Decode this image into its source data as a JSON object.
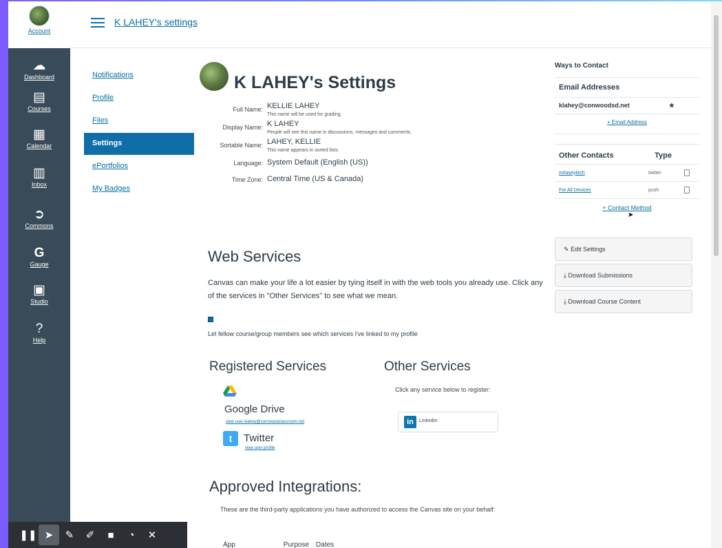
{
  "global_nav": {
    "account_label": "Account",
    "items": [
      {
        "label": "Dashboard",
        "icon": "dashboard-icon",
        "glyph": "☁"
      },
      {
        "label": "Courses",
        "icon": "courses-icon",
        "glyph": "▤"
      },
      {
        "label": "Calendar",
        "icon": "calendar-icon",
        "glyph": "▦"
      },
      {
        "label": "Inbox",
        "icon": "inbox-icon",
        "glyph": "▥"
      },
      {
        "label": "Commons",
        "icon": "commons-icon",
        "glyph": "➲"
      },
      {
        "label": "Gauge",
        "icon": "gauge-icon",
        "glyph": "G"
      },
      {
        "label": "Studio",
        "icon": "studio-icon",
        "glyph": "▣"
      },
      {
        "label": "Help",
        "icon": "help-icon",
        "glyph": "?"
      }
    ]
  },
  "toolbar": {
    "items": [
      "pause-icon",
      "pointer-icon",
      "pen-icon",
      "marker-icon",
      "camera-icon",
      "timer-icon",
      "close-icon"
    ]
  },
  "header": {
    "breadcrumb": "K LAHEY's settings"
  },
  "subnav": {
    "items": [
      "Notifications",
      "Profile",
      "Files",
      "Settings",
      "ePortfolios",
      "My Badges"
    ],
    "active": "Settings"
  },
  "profile": {
    "title": "K LAHEY's Settings",
    "fields": [
      {
        "label": "Full Name:",
        "value": "KELLIE LAHEY",
        "note": "This name will be used for grading."
      },
      {
        "label": "Display Name:",
        "value": "K LAHEY",
        "note": "People will see this name in discussions, messages and comments."
      },
      {
        "label": "Sortable Name:",
        "value": "LAHEY, KELLIE",
        "note": "This name appears in sorted lists."
      },
      {
        "label": "Language:",
        "value": "System Default (English (US))",
        "note": ""
      },
      {
        "label": "Time Zone:",
        "value": "Central Time (US & Canada)",
        "note": ""
      }
    ]
  },
  "web_services": {
    "title": "Web Services",
    "description": "Canvas can make your life a lot easier by tying itself in with the web tools you already use. Click any of the services in \"Other Services\" to see what we mean.",
    "checkbox_label": "Let fellow course/group members see which services I've linked to my profile",
    "checkbox_checked": true,
    "registered_title": "Registered Services",
    "registered": [
      {
        "name": "Google Drive",
        "link": "view user-kiahey@cornwoodclassroom.net"
      },
      {
        "name": "Twitter",
        "link": "view user profile"
      }
    ],
    "other_title": "Other Services",
    "other_desc": "Click any service below to register:",
    "other": [
      {
        "name": "LinkedIn"
      }
    ]
  },
  "integrations": {
    "title": "Approved Integrations:",
    "description": "These are the third-party applications you have authorized to access the Canvas site on your behalf:",
    "columns": [
      "App",
      "Purpose",
      "Dates"
    ]
  },
  "aside": {
    "ways_title": "Ways to Contact",
    "email_header": "Email Addresses",
    "email": "klahey@conwoodsd.net",
    "add_email": "+ Email Address",
    "other_header": "Other Contacts",
    "type_header": "Type",
    "contacts": [
      {
        "name": "mrlaseytech",
        "type": "twitter"
      },
      {
        "name": "For All Devices",
        "type": "push"
      }
    ],
    "add_contact": "+ Contact Method",
    "buttons": [
      "Edit Settings",
      "Download Submissions",
      "Download Course Content"
    ]
  },
  "colors": {
    "nav_bg": "#394b58",
    "link": "#0770a3",
    "active_bg": "#0f6ea8",
    "text": "#2d3b45"
  }
}
